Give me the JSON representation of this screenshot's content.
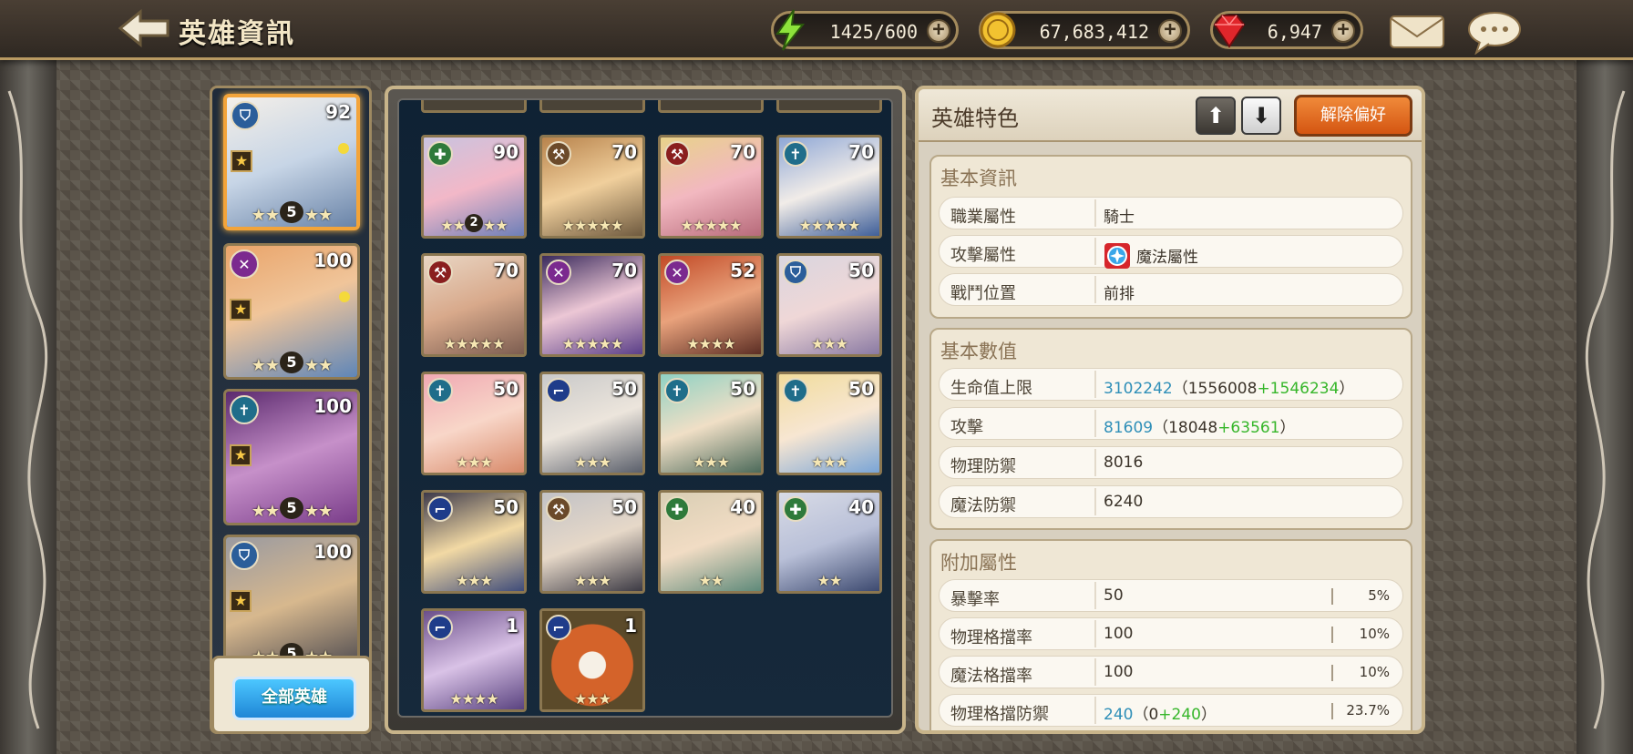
{
  "header": {
    "title": "英雄資訊"
  },
  "resources": {
    "stamina": {
      "value": "1425/600",
      "icon": "lightning-icon"
    },
    "gold": {
      "value": "67,683,412",
      "icon": "coin-icon"
    },
    "gems": {
      "value": "6,947",
      "icon": "ruby-icon"
    }
  },
  "left_list": {
    "heroes": [
      {
        "level": "92",
        "grade": "5",
        "class_icon": "shield-icon"
      },
      {
        "level": "100",
        "grade": "5",
        "class_icon": "crossed-swords-icon"
      },
      {
        "level": "100",
        "grade": "5",
        "class_icon": "cross-icon"
      },
      {
        "level": "100",
        "grade": "5",
        "class_icon": "shield-icon"
      }
    ],
    "all_heroes_label": "全部英雄"
  },
  "grid": {
    "heroes": [
      {
        "level": "90",
        "grade": "2"
      },
      {
        "level": "70"
      },
      {
        "level": "70"
      },
      {
        "level": "70"
      },
      {
        "level": "70"
      },
      {
        "level": "70"
      },
      {
        "level": "52"
      },
      {
        "level": "50"
      },
      {
        "level": "50"
      },
      {
        "level": "50"
      },
      {
        "level": "50"
      },
      {
        "level": "50"
      },
      {
        "level": "50"
      },
      {
        "level": "50"
      },
      {
        "level": "40"
      },
      {
        "level": "40"
      },
      {
        "level": "1"
      },
      {
        "level": "1"
      }
    ]
  },
  "detail": {
    "title": "英雄特色",
    "unfavorite_label": "解除偏好",
    "basic_info": {
      "title": "基本資訊",
      "class_label": "職業屬性",
      "class_value": "騎士",
      "attack_type_label": "攻擊屬性",
      "attack_type_value": "魔法屬性",
      "position_label": "戰鬥位置",
      "position_value": "前排"
    },
    "basic_stats": {
      "title": "基本數值",
      "hp_label": "生命值上限",
      "hp_total": "3102242",
      "hp_open": "（1556008",
      "hp_bonus": "+1546234",
      "hp_close": "）",
      "atk_label": "攻擊",
      "atk_total": "81609",
      "atk_open": "（18048",
      "atk_bonus": "+63561",
      "atk_close": "）",
      "pdef_label": "物理防禦",
      "pdef_value": "8016",
      "mdef_label": "魔法防禦",
      "mdef_value": "6240"
    },
    "extra": {
      "title": "附加屬性",
      "crit_label": "暴擊率",
      "crit_value": "50",
      "crit_pct": "5%",
      "pblock_label": "物理格擋率",
      "pblock_value": "100",
      "pblock_pct": "10%",
      "mblock_label": "魔法格擋率",
      "mblock_value": "100",
      "mblock_pct": "10%",
      "pblockdef_label": "物理格擋防禦",
      "pblockdef_total": "240",
      "pblockdef_open": "（0",
      "pblockdef_bonus": "+240",
      "pblockdef_close": "）",
      "pblockdef_pct": "23.7%"
    }
  },
  "colors": {
    "accent_orange": "#e0641c",
    "blue_button": "#2a9be6",
    "frame_gold": "#c8b48a"
  }
}
